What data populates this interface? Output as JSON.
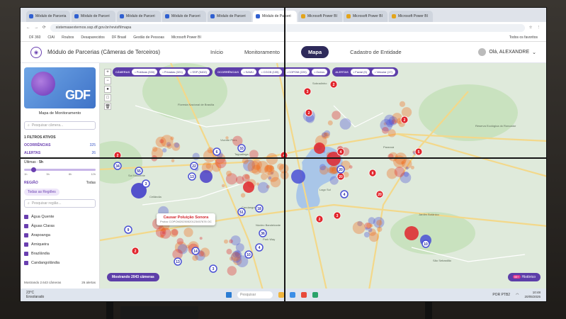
{
  "browser": {
    "tabs": [
      {
        "label": "Módulo de Parceria",
        "active": false
      },
      {
        "label": "Módulo de Parceri",
        "active": false
      },
      {
        "label": "Módulo de Parceri",
        "active": false
      },
      {
        "label": "Módulo de Parceri",
        "active": false
      },
      {
        "label": "Módulo de Parceri",
        "active": false
      },
      {
        "label": "Módulo de Parceri",
        "active": true
      },
      {
        "label": "Microsoft Power BI",
        "active": false
      },
      {
        "label": "Microsoft Power BI",
        "active": false
      },
      {
        "label": "Microsoft Power BI",
        "active": false
      }
    ],
    "url": "sistemasexternos.ssp.df.gov.br/revisfl/mapa",
    "bookmarks": [
      "DF 360",
      "CIAI",
      "Roubos",
      "Desaparecidos",
      "DF Brasil",
      "Gestão de Pessoas",
      "Microsoft Power BI"
    ],
    "all_favorites": "Todos os favoritos"
  },
  "app": {
    "title": "Módulo de Parcerias (Câmeras de Terceiros)",
    "nav": [
      "Início",
      "Monitoramento",
      "Mapa",
      "Cadastro de Entidade"
    ],
    "active_nav": "Mapa",
    "user": "Olá, ALEXANDRE"
  },
  "sidebar": {
    "logo_text": "GDF",
    "title": "Mapa de Monitoramento",
    "search_placeholder": "Pesquisar câmera...",
    "active_filters": "1 FILTROS ATIVOS",
    "ocorrencias_label": "OCORRÊNCIAS",
    "ocorrencias_count": "325",
    "alertas_label": "ALERTAS",
    "alertas_count": "26",
    "ultimas_label": "Últimas",
    "ultimas_value": "5h",
    "slider_ticks": [
      "1h",
      "5h",
      "8h",
      "12h"
    ],
    "regiao_label": "REGIÃO",
    "regiao_value": "Todas",
    "all_regions_chip": "Todas as Regiões",
    "region_search_placeholder": "Pesquisar região...",
    "regions": [
      "Água Quente",
      "Águas Claras",
      "Arapoanga",
      "Arniqueira",
      "Brazlândia",
      "Candangolândia"
    ],
    "footer_left": "Mostrando 2.643 câmeras",
    "footer_right": "26 alertas"
  },
  "filters": {
    "cameras_label": "CÂMERAS",
    "cameras": [
      "Públicas (330)",
      "Privadas (321)",
      "SSP (5402)"
    ],
    "ocorrencias_label": "OCORRÊNCIAS",
    "ocorrencias": [
      "SAMU",
      "CGCB (105)",
      "COPOM (220)",
      "Outros"
    ],
    "alertas_label": "ALERTAS",
    "alertas": [
      "Facial (9)",
      "Veicular (17)"
    ]
  },
  "map": {
    "popup_title": "Causar Poluição Sonora",
    "popup_subtitle": "Protoc COPOM20250520123457678 OC",
    "showing": "Mostrando 2043 câmeras",
    "historico": "Histórico",
    "historico_badge": "99+",
    "places": [
      "Floresta Nacional de Brasília",
      "Taguatinga",
      "Vicente Pires",
      "Sol Nascente",
      "Lago Sul",
      "Park Way",
      "Candangolândia",
      "São Sebastião",
      "Jardim Botânico",
      "Paranoá",
      "Sobradinho",
      "Reserva Ecológica do Roncador",
      "Ceilândia",
      "Núcleo Bandeirante"
    ],
    "red_labels": [
      "2",
      "3",
      "2",
      "4",
      "20",
      "2",
      "3",
      "2",
      "8",
      "2",
      "20",
      "5",
      "4",
      "2"
    ],
    "blue_labels": [
      "6",
      "33",
      "22",
      "51",
      "14",
      "13",
      "18",
      "36",
      "20",
      "4",
      "10",
      "9",
      "3",
      "4",
      "34",
      "55",
      "13",
      "10",
      "3"
    ],
    "colors": {
      "red": "#e0262c",
      "blue": "#4a50d6",
      "orange": "#f26a1b",
      "map_bg": "#dfeadb",
      "water": "#a9c6e8"
    }
  },
  "taskbar": {
    "weather_temp": "23°C",
    "weather_desc": "Ensolarado",
    "search": "Pesquisar",
    "lang1": "POR",
    "lang2": "PTB2",
    "time": "10:48",
    "date": "20/05/2025"
  }
}
